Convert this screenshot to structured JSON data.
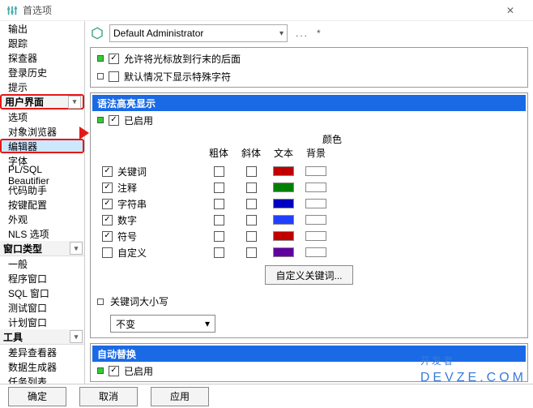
{
  "window": {
    "title": "首选项"
  },
  "toolbar": {
    "combo_value": "Default Administrator",
    "dots": "...",
    "star": "*"
  },
  "sidebar": {
    "cat0": "",
    "items_top": [
      "输出",
      "跟踪",
      "探查器",
      "登录历史",
      "提示"
    ],
    "cat_ui": "用户界面",
    "items_ui": [
      "选项",
      "对象浏览器",
      "编辑器",
      "字体",
      "PL/SQL Beautifier",
      "代码助手",
      "按键配置",
      "外观",
      "NLS 选项"
    ],
    "cat_win": "窗口类型",
    "items_win": [
      "一般",
      "程序窗口",
      "SQL 窗口",
      "测试窗口",
      "计划窗口"
    ],
    "cat_tools": "工具",
    "items_tools": [
      "差异查看器",
      "数据生成器",
      "任务列表"
    ]
  },
  "editor": {
    "allow_cursor_eol": "允许将光标放到行末的后面",
    "show_special_default": "默认情况下显示特殊字符",
    "syntax_header": "语法高亮显示",
    "enabled": "已启用",
    "head_bold": "粗体",
    "head_italic": "斜体",
    "head_color": "颜色",
    "head_text": "文本",
    "head_bg": "背景",
    "rows": [
      {
        "label": "关键词",
        "bold": true,
        "italic": false,
        "text": "#c00000",
        "bg": ""
      },
      {
        "label": "注释",
        "bold": true,
        "italic": false,
        "text": "#008000",
        "bg": ""
      },
      {
        "label": "字符串",
        "bold": true,
        "italic": false,
        "text": "#0000c0",
        "bg": ""
      },
      {
        "label": "数字",
        "bold": true,
        "italic": false,
        "text": "#2040ff",
        "bg": ""
      },
      {
        "label": "符号",
        "bold": true,
        "italic": false,
        "text": "#c00000",
        "bg": ""
      },
      {
        "label": "自定义",
        "bold": false,
        "italic": false,
        "text": "#6000a0",
        "bg": ""
      }
    ],
    "custom_kw_btn": "自定义关键词...",
    "kw_case_label": "关键词大小写",
    "kw_case_value": "不变",
    "auto_replace_header": "自动替换",
    "auto_replace_enabled": "已启用"
  },
  "buttons": {
    "ok": "确定",
    "cancel": "取消",
    "apply": "应用"
  },
  "watermark": {
    "big": "开发者",
    "small": "DEVZE.COM"
  }
}
